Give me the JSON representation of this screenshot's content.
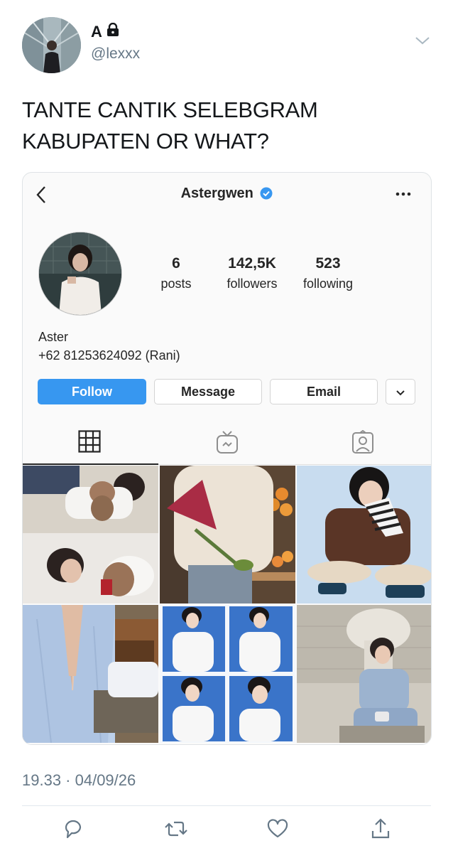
{
  "tweet": {
    "display_name": "A",
    "handle": "@lexxx",
    "text_line1": "TANTE CANTIK SELEBGRAM",
    "text_line2": "KABUPATEN OR WHAT?",
    "timestamp": "19.33 · 04/09/26"
  },
  "instagram": {
    "username": "Astergwen",
    "stats": [
      {
        "value": "6",
        "label": "posts"
      },
      {
        "value": "142,5K",
        "label": "followers"
      },
      {
        "value": "523",
        "label": "following"
      }
    ],
    "bio_name": "Aster",
    "bio_phone": "+62 81253624092 (Rani)",
    "buttons": {
      "follow": "Follow",
      "message": "Message",
      "email": "Email"
    },
    "tabs": [
      "grid-icon",
      "igtv-icon",
      "tagged-icon"
    ]
  },
  "actions": [
    "reply-icon",
    "retweet-icon",
    "like-icon",
    "share-icon"
  ],
  "colors": {
    "accent": "#3797f0",
    "verified": "#3897f0",
    "muted": "#657786"
  }
}
